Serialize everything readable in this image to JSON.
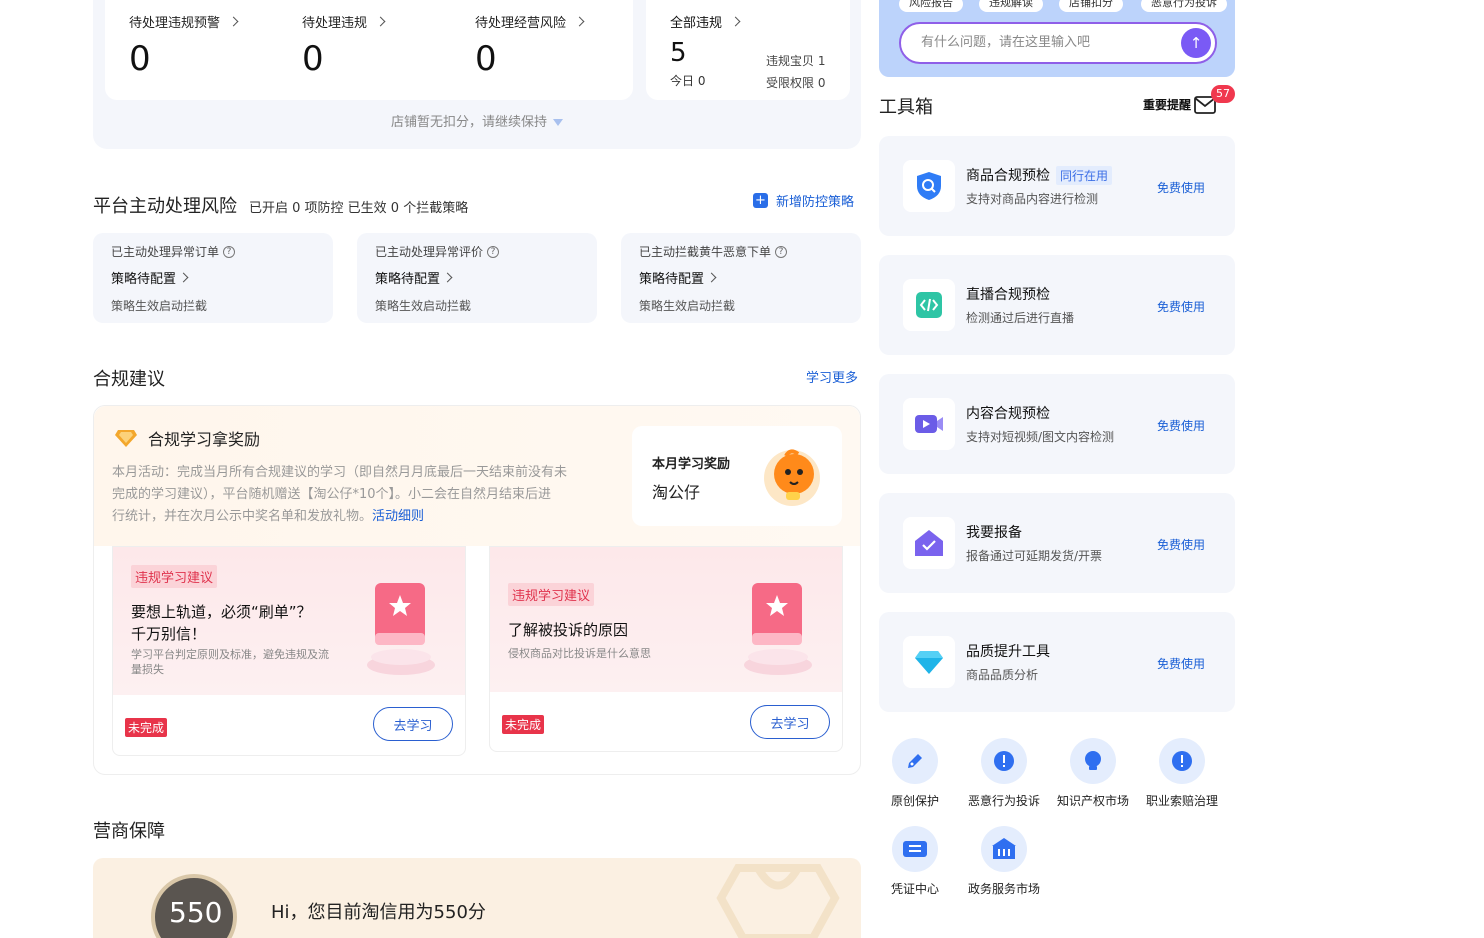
{
  "stats": {
    "items": [
      {
        "label": "待处理违规预警",
        "value": "0"
      },
      {
        "label": "待处理违规",
        "value": "0"
      },
      {
        "label": "待处理经营风险",
        "value": "0"
      }
    ],
    "all_violations": {
      "label": "全部违规",
      "value": "5",
      "today": "今日 0",
      "item_violation": "违规宝贝 1",
      "limited_rights": "受限权限 0"
    },
    "note": "店铺暂无扣分，请继续保持"
  },
  "risk": {
    "title": "平台主动处理风险",
    "meta": "已开启 0 项防控 已生效 0 个拦截策略",
    "add_link": "新增防控策略",
    "cards": [
      {
        "title": "已主动处理异常订单",
        "status": "策略待配置",
        "desc": "策略生效启动拦截"
      },
      {
        "title": "已主动处理异常评价",
        "status": "策略待配置",
        "desc": "策略生效启动拦截"
      },
      {
        "title": "已主动拦截黄牛恶意下单",
        "status": "策略待配置",
        "desc": "策略生效启动拦截"
      }
    ]
  },
  "advice": {
    "title": "合规建议",
    "more_link": "学习更多",
    "reward_title": "合规学习拿奖励",
    "reward_desc_1": "本月活动：完成当月所有合规建议的学习（即自然月月底最后一天结束前没有未",
    "reward_desc_2": "完成的学习建议），平台随机赠送【淘公仔*10个】。小二会在自然月结束后进",
    "reward_desc_3": "行统计，并在次月公示中奖名单和发放礼物。",
    "reward_detail_link": "活动细则",
    "monthly_label": "本月学习奖励",
    "monthly_prize": "淘公仔",
    "cards": [
      {
        "tag": "违规学习建议",
        "title_1": "要想上轨道，必须“刷单”？",
        "title_2": "千万别信！",
        "desc_1": "学习平台判定原则及标准，避免违规及流",
        "desc_2": "量损失",
        "status": "未完成",
        "button": "去学习"
      },
      {
        "tag": "违规学习建议",
        "title_1": "了解被投诉的原因",
        "title_2": "",
        "desc_1": "侵权商品对比投诉是什么意思",
        "desc_2": "",
        "status": "未完成",
        "button": "去学习"
      }
    ]
  },
  "merchant": {
    "title": "营商保障",
    "score": "550",
    "greeting": "Hi，您目前淘信用为550分"
  },
  "assistant": {
    "pills": [
      "风险报告",
      "违规解读",
      "店铺扣分",
      "恶意行为投诉"
    ],
    "placeholder": "有什么问题，请在这里输入吧",
    "send_icon": "↑"
  },
  "toolbox": {
    "title": "工具箱",
    "reminder": "重要提醒",
    "badge": "57",
    "tools": [
      {
        "name": "商品合规预检",
        "tag": "同行在用",
        "desc": "支持对商品内容进行检测",
        "action": "免费使用",
        "icon": "shield-search-icon"
      },
      {
        "name": "直播合规预检",
        "tag": "",
        "desc": "检测通过后进行直播",
        "action": "免费使用",
        "icon": "code-icon"
      },
      {
        "name": "内容合规预检",
        "tag": "",
        "desc": "支持对短视频/图文内容检测",
        "action": "免费使用",
        "icon": "video-icon"
      },
      {
        "name": "我要报备",
        "tag": "",
        "desc": "报备通过可延期发货/开票",
        "action": "免费使用",
        "icon": "envelope-check-icon"
      },
      {
        "name": "品质提升工具",
        "tag": "",
        "desc": "商品品质分析",
        "action": "免费使用",
        "icon": "diamond-icon"
      }
    ],
    "shortcuts": [
      {
        "label": "原创保护",
        "icon": "edit-icon"
      },
      {
        "label": "恶意行为投诉",
        "icon": "alert-icon"
      },
      {
        "label": "知识产权市场",
        "icon": "bulb-icon"
      },
      {
        "label": "职业索赔治理",
        "icon": "alert-icon"
      },
      {
        "label": "凭证中心",
        "icon": "ticket-icon"
      },
      {
        "label": "政务服务市场",
        "icon": "bank-icon"
      }
    ]
  },
  "colors": {
    "accent_blue": "#1a5fd6",
    "danger_red": "#e8344a",
    "purple": "#7a5af5"
  }
}
